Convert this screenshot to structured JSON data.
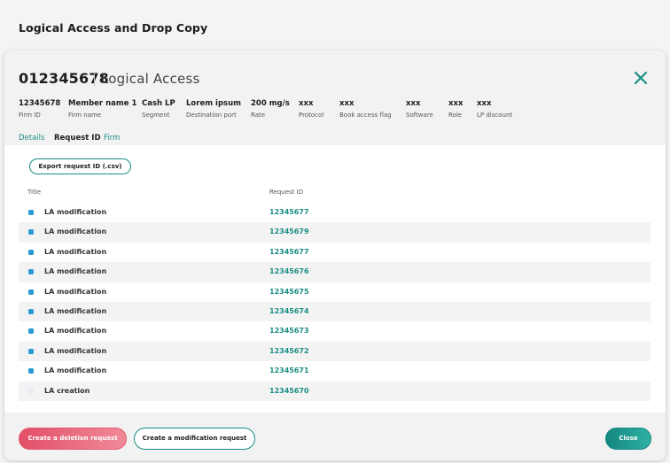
{
  "page": {
    "title": "Logical Access and Drop Copy"
  },
  "modal": {
    "firm_number": "012345678",
    "subtitle": "Logical Access",
    "meta": [
      {
        "value": "12345678",
        "label": "Firm ID"
      },
      {
        "value": "Member name 1",
        "label": "Firm name"
      },
      {
        "value": "Cash LP",
        "label": "Segment"
      },
      {
        "value": "Lorem ipsum",
        "label": "Destination port"
      },
      {
        "value": "200 mg/s",
        "label": "Rate"
      },
      {
        "value": "xxx",
        "label": "Protocol"
      },
      {
        "value": "xxx",
        "label": "Book access flag"
      },
      {
        "value": "xxx",
        "label": "Software"
      },
      {
        "value": "xxx",
        "label": "Role"
      },
      {
        "value": "xxx",
        "label": "LP discount"
      }
    ],
    "tabs": [
      {
        "label": "Details"
      },
      {
        "label": "Request ID",
        "active": true
      },
      {
        "label": "Firm"
      }
    ],
    "export_button": "Export request ID (.csv)",
    "table": {
      "columns": [
        "Title",
        "Request ID"
      ],
      "rows": [
        {
          "title": "LA modification",
          "request_id": "12345677"
        },
        {
          "title": "LA modification",
          "request_id": "12345679"
        },
        {
          "title": "LA modification",
          "request_id": "12345677"
        },
        {
          "title": "LA modification",
          "request_id": "12345676"
        },
        {
          "title": "LA modification",
          "request_id": "12345675"
        },
        {
          "title": "LA modification",
          "request_id": "12345674"
        },
        {
          "title": "LA modification",
          "request_id": "12345673"
        },
        {
          "title": "LA modification",
          "request_id": "12345672"
        },
        {
          "title": "LA modification",
          "request_id": "12345671"
        },
        {
          "title": "LA creation",
          "request_id": "12345670"
        }
      ]
    },
    "footer": {
      "delete_label": "Create a deletion request",
      "modify_label": "Create a modification request",
      "close_label": "Close"
    }
  },
  "colors": {
    "accent": "#1a8d84",
    "danger": "#e24f67",
    "row_marker": "#2b9bd4",
    "row_marker_creation": "#e3edf5"
  },
  "icons": {
    "close": "close-icon",
    "row_marker": "status-marker-icon"
  }
}
